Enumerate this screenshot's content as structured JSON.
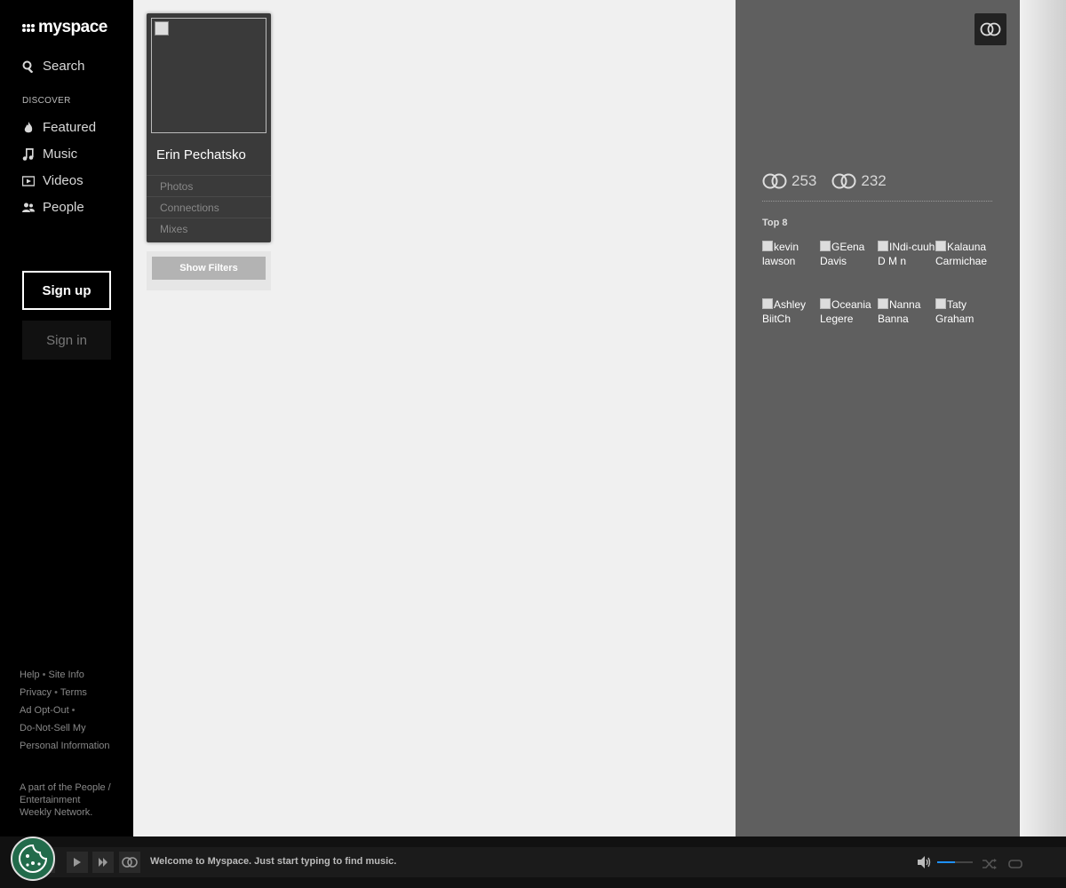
{
  "app": {
    "logo_text": "myspace"
  },
  "sidebar": {
    "search_label": "Search",
    "discover_heading": "DISCOVER",
    "items": [
      {
        "label": "Featured",
        "icon": "flame-icon"
      },
      {
        "label": "Music",
        "icon": "music-note-icon"
      },
      {
        "label": "Videos",
        "icon": "video-icon"
      },
      {
        "label": "People",
        "icon": "people-icon"
      }
    ],
    "signup_label": "Sign up",
    "signin_label": "Sign in",
    "footer": {
      "help": "Help",
      "site_info": "Site Info",
      "privacy": "Privacy",
      "terms": "Terms",
      "ad_opt_out": "Ad Opt-Out",
      "do_not_sell": "Do-Not-Sell My Personal Information"
    },
    "network_text": "A part of the People / Entertainment Weekly Network."
  },
  "profile": {
    "name": "Erin Pechatsko",
    "links": [
      "Photos",
      "Connections",
      "Mixes"
    ],
    "show_filters_label": "Show Filters"
  },
  "panel": {
    "connections_in": "253",
    "connections_out": "232",
    "top8_title": "Top 8",
    "top8": [
      "kevin lawson",
      "GEena Davis",
      "INdi-cuuh D M n",
      "Kalauna Carmichae",
      "Ashley BiitCh",
      "Oceania Legere",
      "Nanna Banna",
      "Taty Graham"
    ]
  },
  "player": {
    "welcome_text": "Welcome to Myspace. Just start typing to find music.",
    "volume_level": 0.5,
    "accent_color": "#1e90ff"
  }
}
